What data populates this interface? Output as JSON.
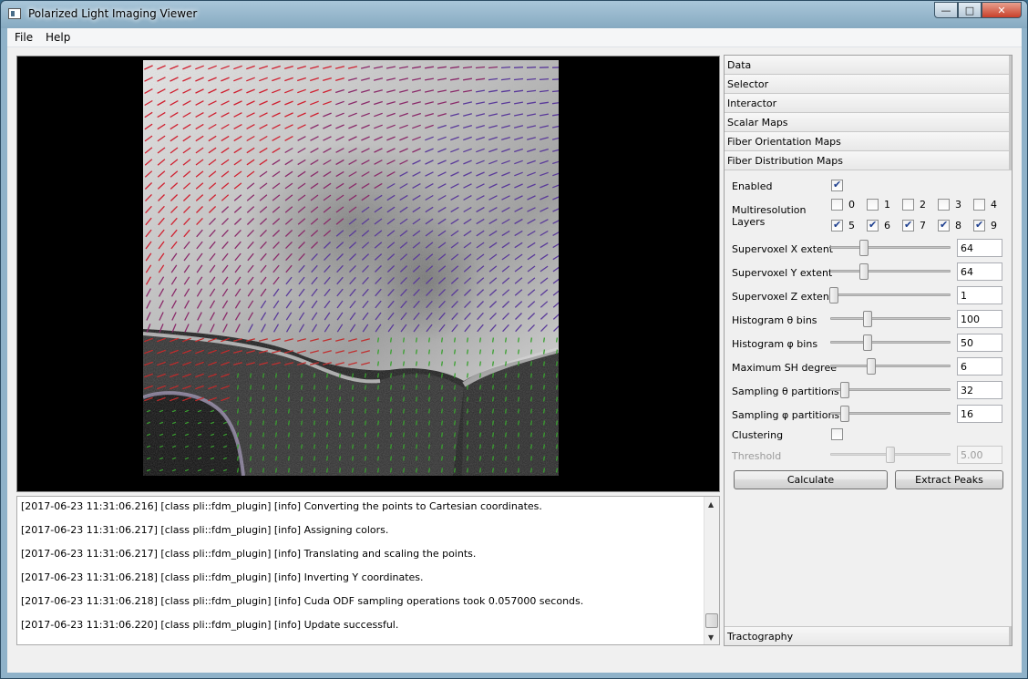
{
  "window": {
    "title": "Polarized Light Imaging Viewer",
    "min": "—",
    "max": "□",
    "close": "✕"
  },
  "menu": {
    "file": "File",
    "help": "Help"
  },
  "log": {
    "lines": [
      "[2017-06-23 11:31:06.216] [class pli::fdm_plugin] [info] Converting the points to Cartesian coordinates.",
      "[2017-06-23 11:31:06.217] [class pli::fdm_plugin] [info] Assigning colors.",
      "[2017-06-23 11:31:06.217] [class pli::fdm_plugin] [info] Translating and scaling the points.",
      "[2017-06-23 11:31:06.218] [class pli::fdm_plugin] [info] Inverting Y coordinates.",
      "[2017-06-23 11:31:06.218] [class pli::fdm_plugin] [info] Cuda ODF sampling operations took 0.057000 seconds.",
      "[2017-06-23 11:31:06.220] [class pli::fdm_plugin] [info] Update successful."
    ]
  },
  "panel": {
    "sections": [
      "Data",
      "Selector",
      "Interactor",
      "Scalar Maps",
      "Fiber Orientation Maps",
      "Fiber Distribution Maps"
    ],
    "bottom_section": "Tractography",
    "enabled_label": "Enabled",
    "enabled": true,
    "multires_label_1": "Multiresolution",
    "multires_label_2": "Layers",
    "layers": [
      {
        "label": "0",
        "checked": false
      },
      {
        "label": "1",
        "checked": false
      },
      {
        "label": "2",
        "checked": false
      },
      {
        "label": "3",
        "checked": false
      },
      {
        "label": "4",
        "checked": false
      },
      {
        "label": "5",
        "checked": true
      },
      {
        "label": "6",
        "checked": true
      },
      {
        "label": "7",
        "checked": true
      },
      {
        "label": "8",
        "checked": true
      },
      {
        "label": "9",
        "checked": true
      }
    ],
    "sliders": [
      {
        "label": "Supervoxel X extent",
        "value": "64",
        "level": 0.27
      },
      {
        "label": "Supervoxel Y extent",
        "value": "64",
        "level": 0.27
      },
      {
        "label": "Supervoxel Z extent",
        "value": "1",
        "level": 0.0
      },
      {
        "label": "Histogram θ bins",
        "value": "100",
        "level": 0.3
      },
      {
        "label": "Histogram φ bins",
        "value": "50",
        "level": 0.3
      },
      {
        "label": "Maximum SH degree",
        "value": "6",
        "level": 0.33
      },
      {
        "label": "Sampling θ partitions",
        "value": "32",
        "level": 0.1
      },
      {
        "label": "Sampling φ partitions",
        "value": "16",
        "level": 0.1
      }
    ],
    "clustering_label": "Clustering",
    "clustering": false,
    "threshold_label": "Threshold",
    "threshold_value": "5.00",
    "threshold_level": 0.5,
    "calculate": "Calculate",
    "extract_peaks": "Extract Peaks"
  }
}
